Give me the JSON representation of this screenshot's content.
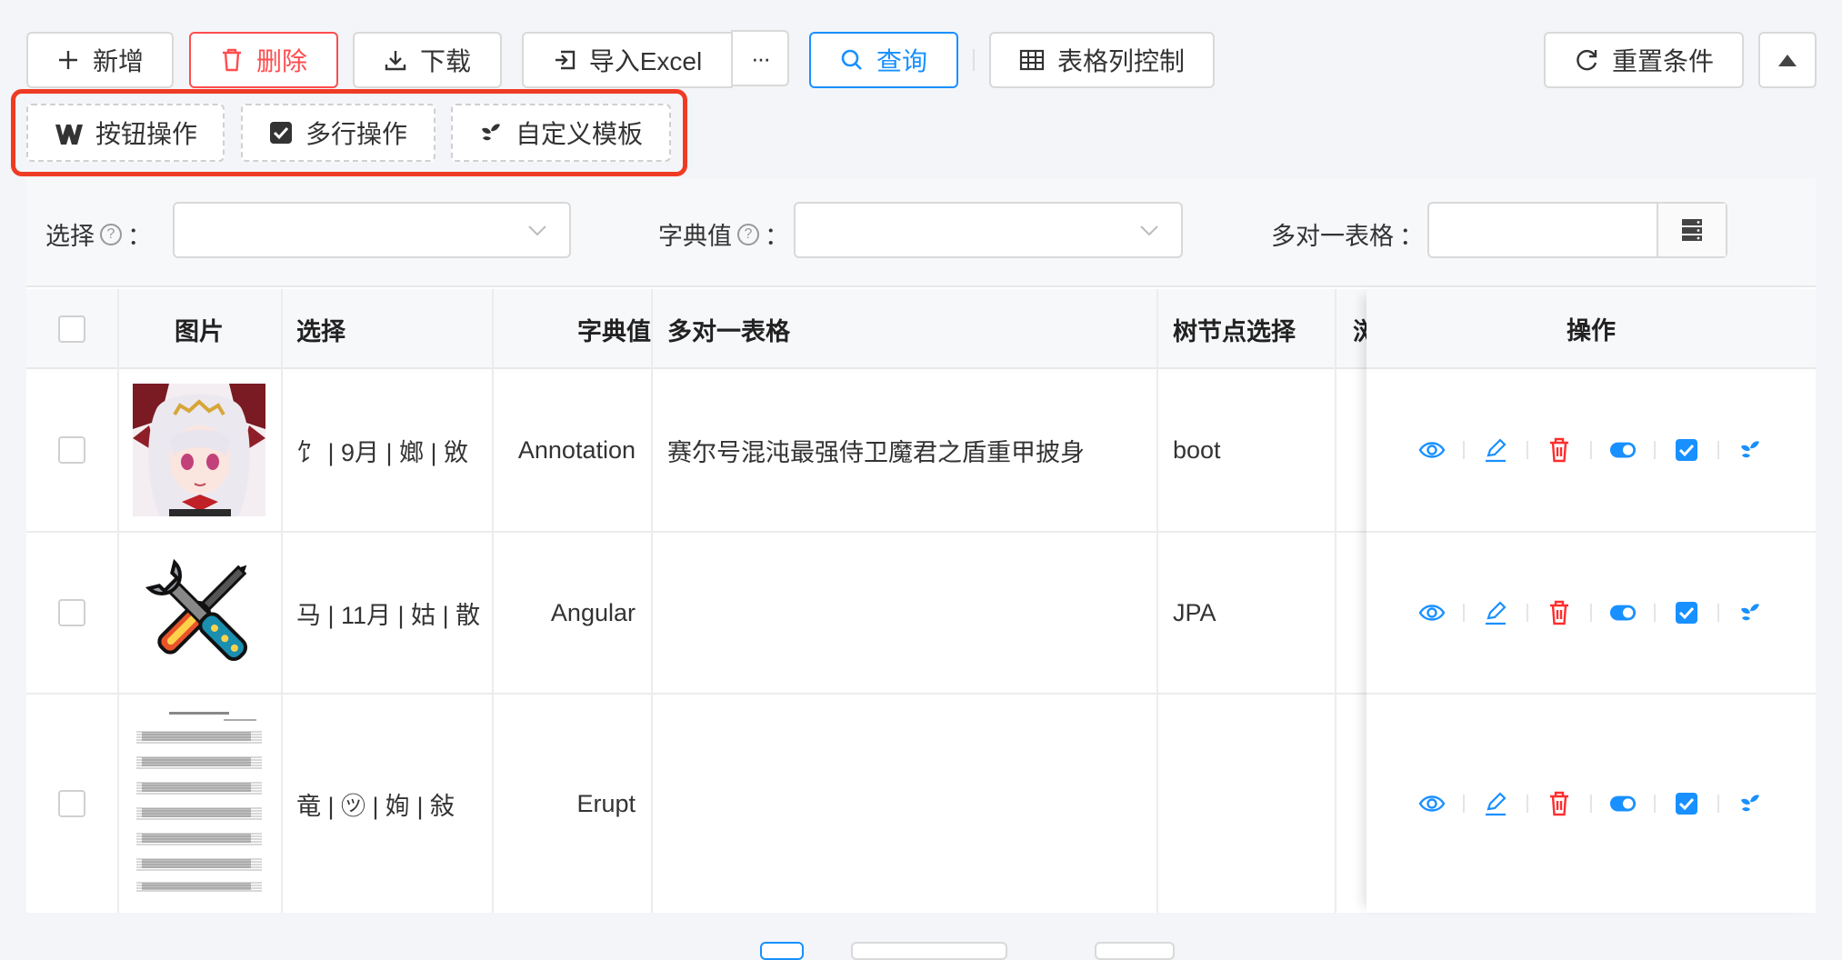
{
  "toolbar": {
    "add": "新增",
    "delete": "删除",
    "download": "下载",
    "import_excel": "导入Excel",
    "more": "···",
    "query": "查询",
    "column_control": "表格列控制",
    "reset": "重置条件"
  },
  "custom_toolbar": {
    "button_ops": "按钮操作",
    "multi_row_ops": "多行操作",
    "custom_template": "自定义模板"
  },
  "search": {
    "select_label": "选择",
    "dict_label": "字典值",
    "many_to_one_label": "多对一表格",
    "colon": "：",
    "help_mark": "?"
  },
  "table": {
    "headers": {
      "image": "图片",
      "select": "选择",
      "dict": "字典值",
      "many_to_one": "多对一表格",
      "tree": "树节点选择",
      "clipped": "浏",
      "ops": "操作"
    },
    "rows": [
      {
        "image": "anime-character-avatar",
        "select": "饣 | 9月 | 嫏 | 敓",
        "dict": "Annotation",
        "many_to_one": "赛尔号混沌最强侍卫魔君之盾重甲披身",
        "tree": "boot"
      },
      {
        "image": "crossed-tools",
        "select": "马 | 11月 | 姑 | 散",
        "dict": "Angular",
        "many_to_one": "",
        "tree": "JPA"
      },
      {
        "image": "sheet-music",
        "select": "竜 | ㋡ | 姰 | 敍",
        "dict": "Erupt",
        "many_to_one": "",
        "tree": ""
      }
    ]
  },
  "colors": {
    "primary": "#1890ff",
    "danger": "#ff4d4f",
    "highlight": "#ef3b24"
  }
}
